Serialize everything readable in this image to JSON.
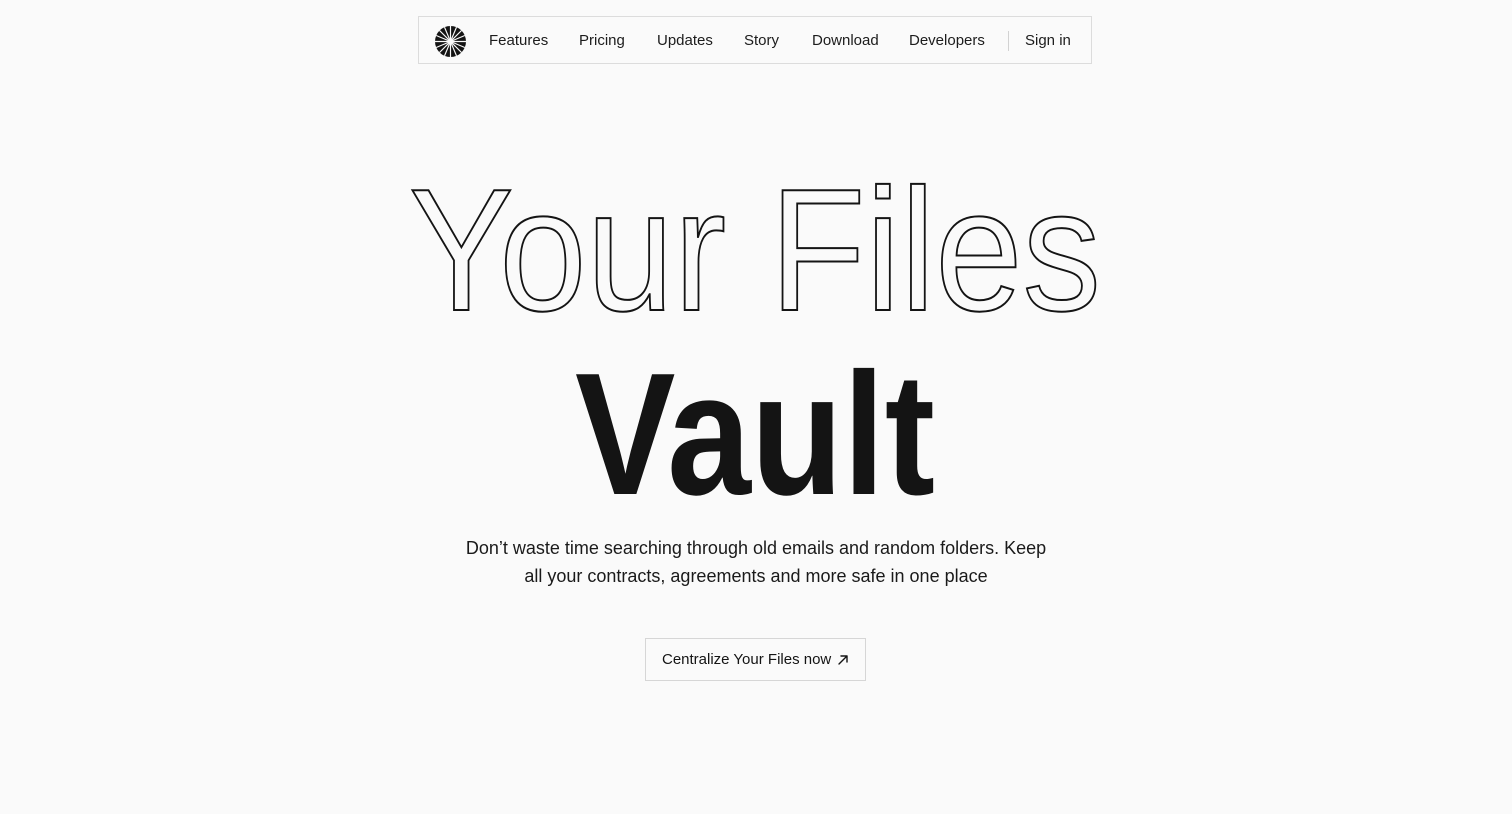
{
  "nav": {
    "logo_icon": "starburst-logo-icon",
    "links": [
      "Features",
      "Pricing",
      "Updates",
      "Story",
      "Download",
      "Developers"
    ],
    "sign_in": "Sign in"
  },
  "hero": {
    "title_outline": "Your Files",
    "title_solid": "Vault",
    "subtitle_line1": "Don’t waste time searching through old emails and random folders. Keep",
    "subtitle_line2": "all your contracts, agreements and more safe in one place"
  },
  "cta": {
    "label": "Centralize Your Files now",
    "icon": "arrow-up-right-icon"
  },
  "colors": {
    "background": "#fafafa",
    "text": "#141414",
    "border": "#dcdcdc"
  }
}
